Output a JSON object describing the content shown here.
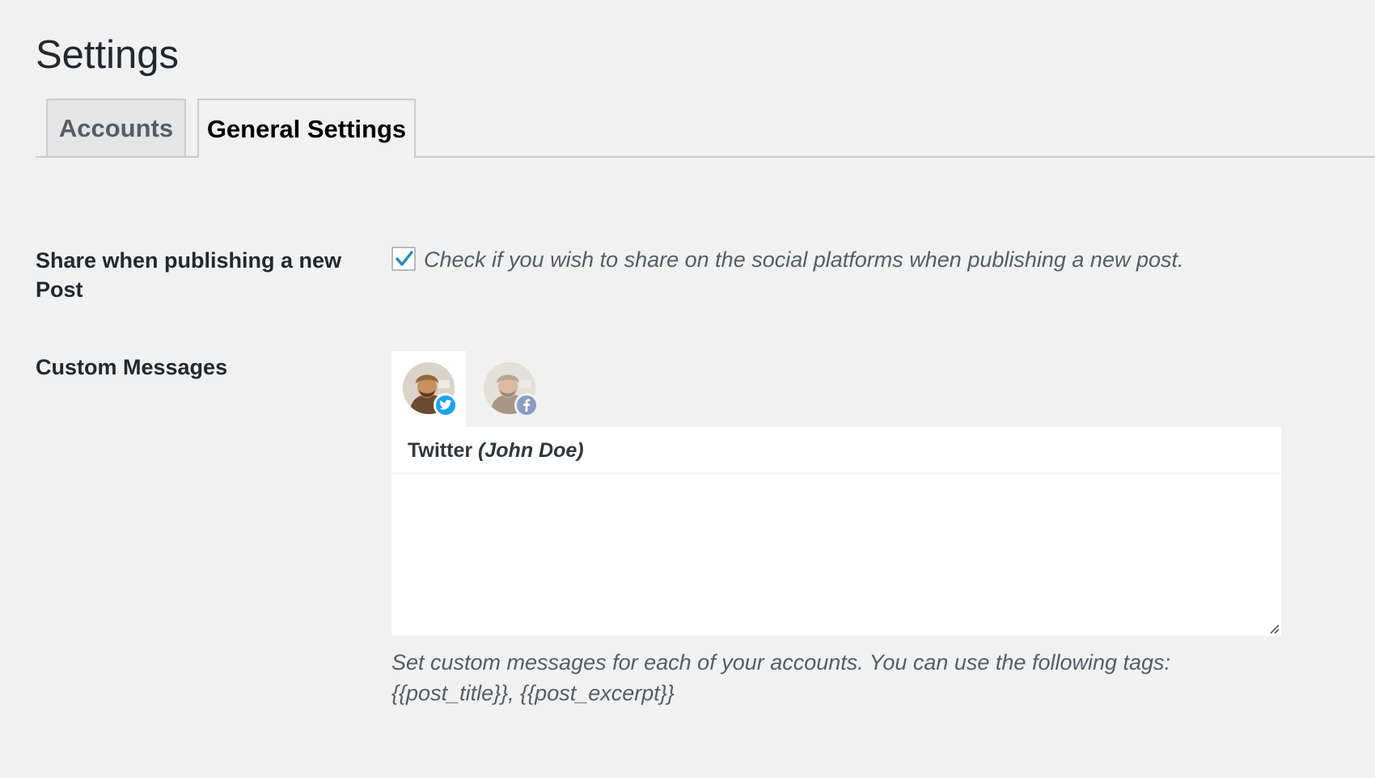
{
  "page": {
    "title": "Settings"
  },
  "tabs": [
    {
      "label": "Accounts",
      "active": false
    },
    {
      "label": "General Settings",
      "active": true
    }
  ],
  "share_row": {
    "label": "Share when publishing a new Post",
    "checked": true,
    "description": "Check if you wish to share on the social platforms when publishing a new post."
  },
  "custom_messages": {
    "label": "Custom Messages",
    "accounts": [
      {
        "network": "twitter",
        "icon": "twitter-icon",
        "active": true
      },
      {
        "network": "facebook",
        "icon": "facebook-icon",
        "active": false
      }
    ],
    "active_network": "Twitter",
    "active_account_name": "(John Doe)",
    "message_value": "",
    "help_text": "Set custom messages for each of your accounts. You can use the following tags: {{post_title}}, {{post_excerpt}}"
  },
  "colors": {
    "background": "#f1f1f1",
    "checkmark": "#1e8cbe",
    "twitter": "#1da1f2",
    "facebook": "#8b9dc3"
  }
}
